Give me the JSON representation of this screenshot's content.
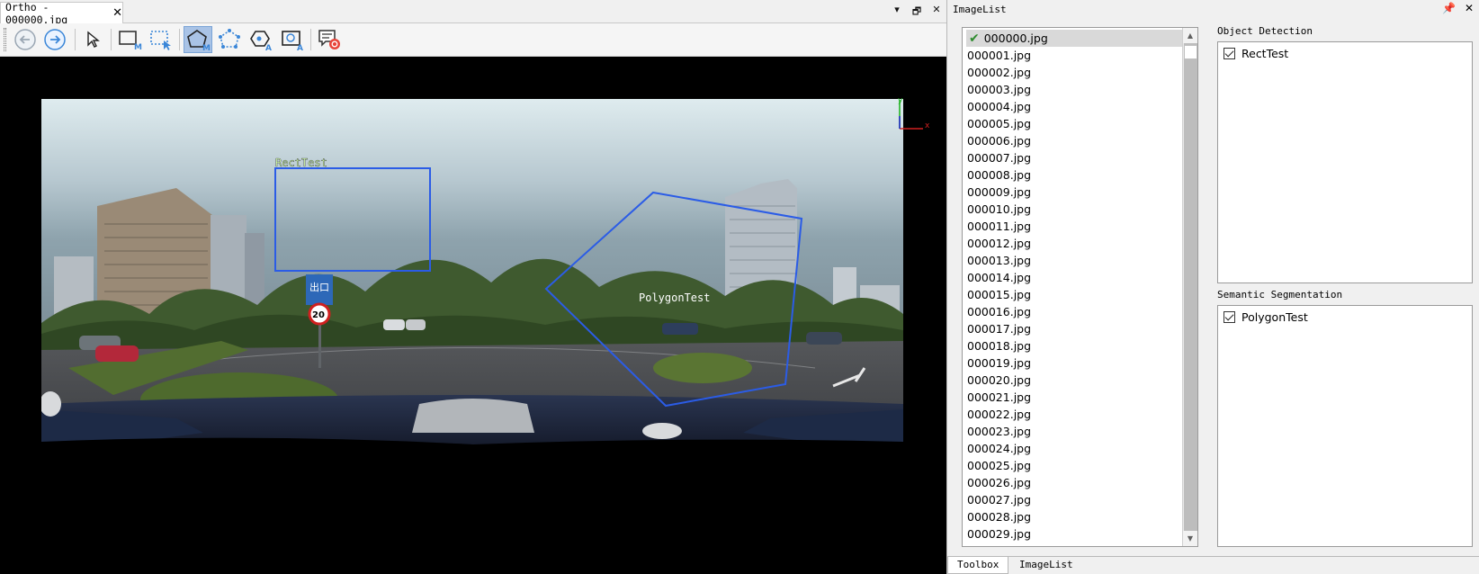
{
  "document": {
    "tab_title": "Ortho - 000000.jpg",
    "close_glyph": "✕",
    "window_controls": [
      "▾",
      "🗗",
      "✕"
    ]
  },
  "toolbar": {
    "buttons": [
      {
        "name": "back-arrow-icon"
      },
      {
        "name": "forward-arrow-icon"
      },
      {
        "name": "select-pointer-icon"
      },
      {
        "name": "rect-manual-icon",
        "badge": "M"
      },
      {
        "name": "rect-select-icon"
      },
      {
        "name": "polygon-manual-icon",
        "badge": "M",
        "active": true
      },
      {
        "name": "polygon-points-icon"
      },
      {
        "name": "polygon-auto-icon",
        "badge": "A"
      },
      {
        "name": "rect-auto-icon",
        "badge": "A"
      },
      {
        "name": "comment-record-icon"
      }
    ]
  },
  "canvas": {
    "annotations": [
      {
        "type": "rect",
        "label": "RectTest",
        "color": "#2b5ce6"
      },
      {
        "type": "polygon",
        "label": "PolygonTest",
        "color": "#2b5ce6"
      }
    ],
    "axis": {
      "x_label": "x",
      "y_label": "y"
    },
    "sign_texts": {
      "exit": "出口",
      "speed": "20"
    }
  },
  "dock": {
    "title": "ImageList",
    "controls": [
      "📌",
      "✕"
    ],
    "images": [
      "000000.jpg",
      "000001.jpg",
      "000002.jpg",
      "000003.jpg",
      "000004.jpg",
      "000005.jpg",
      "000006.jpg",
      "000007.jpg",
      "000008.jpg",
      "000009.jpg",
      "000010.jpg",
      "000011.jpg",
      "000012.jpg",
      "000013.jpg",
      "000014.jpg",
      "000015.jpg",
      "000016.jpg",
      "000017.jpg",
      "000018.jpg",
      "000019.jpg",
      "000020.jpg",
      "000021.jpg",
      "000022.jpg",
      "000023.jpg",
      "000024.jpg",
      "000025.jpg",
      "000026.jpg",
      "000027.jpg",
      "000028.jpg",
      "000029.jpg"
    ],
    "selected_index": 0,
    "selected_check": "✔",
    "object_detection": {
      "title": "Object Detection",
      "items": [
        {
          "label": "RectTest",
          "checked": true
        }
      ]
    },
    "semantic_segmentation": {
      "title": "Semantic Segmentation",
      "items": [
        {
          "label": "PolygonTest",
          "checked": true
        }
      ]
    },
    "bottom_tabs": [
      {
        "label": "Toolbox",
        "active": true
      },
      {
        "label": "ImageList",
        "active": false
      }
    ]
  }
}
